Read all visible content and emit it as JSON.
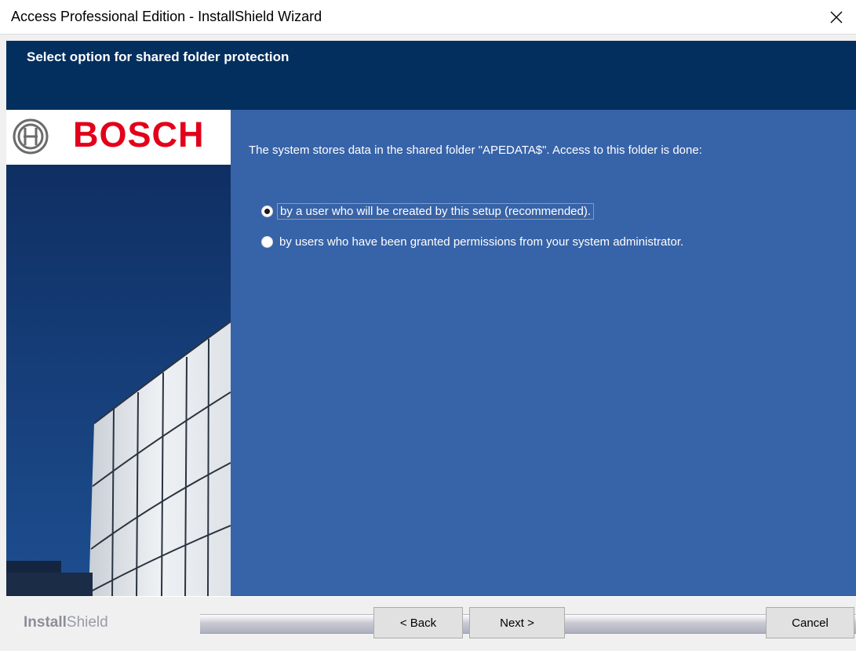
{
  "window": {
    "title": "Access Professional Edition - InstallShield Wizard",
    "close_glyph": "✕"
  },
  "header": {
    "heading": "Select option for shared folder protection",
    "background": "#022f5e"
  },
  "logo": {
    "word": "BOSCH",
    "word_color": "#e2001a",
    "symbol": "bosch-armature-icon"
  },
  "main": {
    "background": "#3763a8",
    "intro": "The system stores data in the shared folder \"APEDATA$\". Access to this folder is done:",
    "options": [
      {
        "label": "by a user who will be created by this setup (recommended).",
        "selected": true
      },
      {
        "label": "by users who have been granted permissions from your system administrator.",
        "selected": false
      }
    ]
  },
  "footer": {
    "brand_bold": "Install",
    "brand_light": "Shield",
    "buttons": {
      "back": "< Back",
      "next": "Next >",
      "cancel": "Cancel"
    }
  }
}
